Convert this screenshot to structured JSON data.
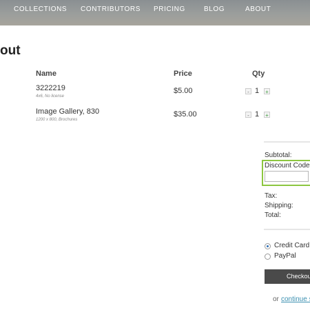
{
  "nav": {
    "items": [
      "COLLECTIONS",
      "CONTRIBUTORS",
      "PRICING",
      "BLOG",
      "ABOUT"
    ]
  },
  "page": {
    "title": "out"
  },
  "cart": {
    "headers": {
      "name": "Name",
      "price": "Price",
      "qty": "Qty"
    },
    "qty_minus": "-",
    "qty_plus": "+",
    "items": [
      {
        "name": "3222219",
        "desc": "4x6, No license",
        "price": "$5.00",
        "qty": "1"
      },
      {
        "name": "Image Gallery, 830",
        "desc": "1200 x 800, Brochures",
        "price": "$35.00",
        "qty": "1"
      }
    ]
  },
  "summary": {
    "subtotal_label": "Subtotal:",
    "discount_label": "Discount Code:",
    "discount_value": "",
    "tax_label": "Tax:",
    "shipping_label": "Shipping:",
    "total_label": "Total:"
  },
  "payment": {
    "options": [
      {
        "label": "Credit Card",
        "selected": true
      },
      {
        "label": "PayPal",
        "selected": false
      }
    ],
    "checkout_label": "Checkout"
  },
  "footer": {
    "or_text": "or",
    "continue_link": "continue s"
  },
  "colors": {
    "highlight": "#8cc63f",
    "checkout_bg": "#4a4a4a",
    "link": "#3a8fb0"
  }
}
